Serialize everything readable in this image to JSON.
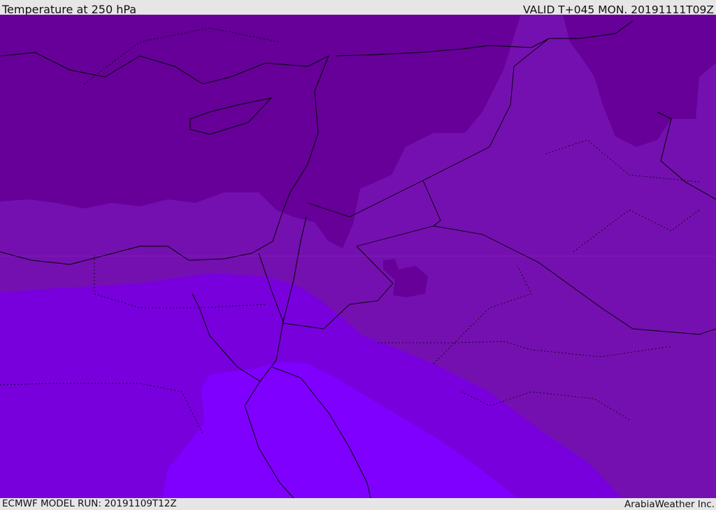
{
  "header": {
    "title": "Temperature at 250 hPa",
    "valid": "VALID T+045 MON. 20191111T09Z"
  },
  "footer": {
    "model_run": "ECMWF MODEL RUN: 20191109T12Z",
    "credit": "ArabiaWeather Inc."
  },
  "colors": {
    "band1": "#660099",
    "band2": "#7510b0",
    "band3": "#7800dd",
    "band4": "#7f00ff"
  }
}
